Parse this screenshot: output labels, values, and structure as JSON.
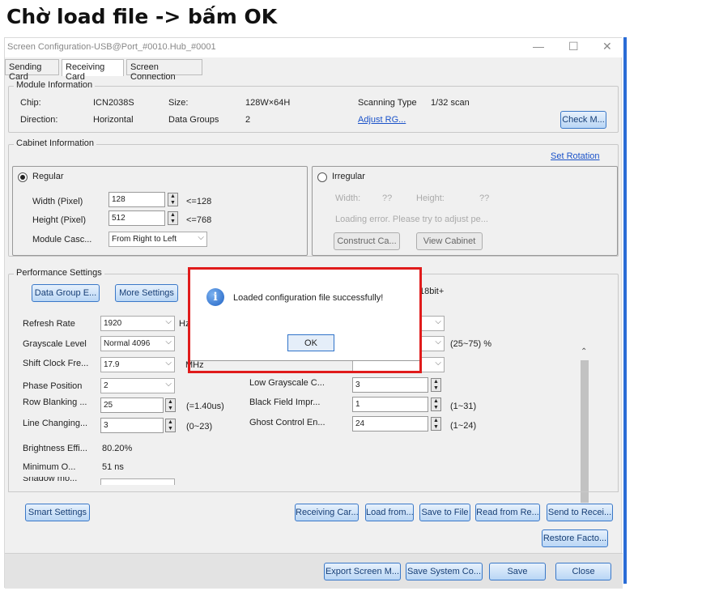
{
  "heading": "Chờ load file -> bấm OK",
  "window": {
    "title": "Screen Configuration-USB@Port_#0010.Hub_#0001",
    "minimize": "—",
    "maximize": "☐",
    "close": "✕"
  },
  "tabs": [
    "Sending Card",
    "Receiving Card",
    "Screen Connection"
  ],
  "module": {
    "legend": "Module Information",
    "chip_label": "Chip:",
    "chip_value": "ICN2038S",
    "size_label": "Size:",
    "size_value": "128W×64H",
    "scan_label": "Scanning Type",
    "scan_value": "1/32 scan",
    "direction_label": "Direction:",
    "direction_value": "Horizontal",
    "datagroups_label": "Data Groups",
    "datagroups_value": "2",
    "adjust_link": "Adjust RG...",
    "check_button": "Check M..."
  },
  "cabinet": {
    "legend": "Cabinet Information",
    "set_rotation": "Set Rotation",
    "regular_label": "Regular",
    "width_label": "Width (Pixel)",
    "width_value": "128",
    "width_hint": "<=128",
    "height_label": "Height (Pixel)",
    "height_value": "512",
    "height_hint": "<=768",
    "cascade_label": "Module Casc...",
    "cascade_value": "From Right to Left",
    "irregular_label": "Irregular",
    "irr_width_label": "Width:",
    "irr_width_value": "??",
    "irr_height_label": "Height:",
    "irr_height_value": "??",
    "loading_error": "Loading error. Please try to adjust pe...",
    "construct_button": "Construct Ca...",
    "view_button": "View Cabinet"
  },
  "performance": {
    "legend": "Performance Settings",
    "datagroup_button": "Data Group E...",
    "more_button": "More Settings",
    "bit_text": "18bit+",
    "refresh_label": "Refresh Rate",
    "refresh_value": "1920",
    "refresh_unit": "Hz",
    "grayscale_label": "Grayscale Level",
    "grayscale_value": "Normal 4096",
    "range_hint": "(25~75) %",
    "shift_label": "Shift Clock Fre...",
    "shift_value": "17.9",
    "shift_unit": "MHz",
    "phase_label": "Phase Position",
    "phase_value": "2",
    "low_gray_label": "Low Grayscale C...",
    "low_gray_value": "3",
    "row_blank_label": "Row Blanking ...",
    "row_blank_value": "25",
    "row_blank_hint": "(=1.40us)",
    "black_field_label": "Black Field Impr...",
    "black_field_value": "1",
    "black_field_hint": "(1~31)",
    "line_change_label": "Line Changing...",
    "line_change_value": "3",
    "line_change_hint": "(0~23)",
    "ghost_label": "Ghost Control En...",
    "ghost_value": "24",
    "ghost_hint": "(1~24)",
    "brightness_label": "Brightness Effi...",
    "brightness_value": "80.20%",
    "minimum_label": "Minimum O...",
    "minimum_value": "51 ns",
    "shadow_label": "Shadow mo..."
  },
  "buttons": {
    "smart": "Smart Settings",
    "receiving": "Receiving Car...",
    "load_from": "Load from...",
    "save_file": "Save to File",
    "read_from": "Read from Re...",
    "send_to": "Send to Recei...",
    "restore": "Restore Facto...",
    "export": "Export Screen M...",
    "save_system": "Save System Co...",
    "save": "Save",
    "close": "Close"
  },
  "dialog": {
    "message": "Loaded configuration file successfully!",
    "ok": "OK",
    "icon": "info-icon"
  },
  "colors": {
    "highlight": "#e01b1b",
    "accent": "#2a6cd6",
    "link": "#1a52c9"
  }
}
